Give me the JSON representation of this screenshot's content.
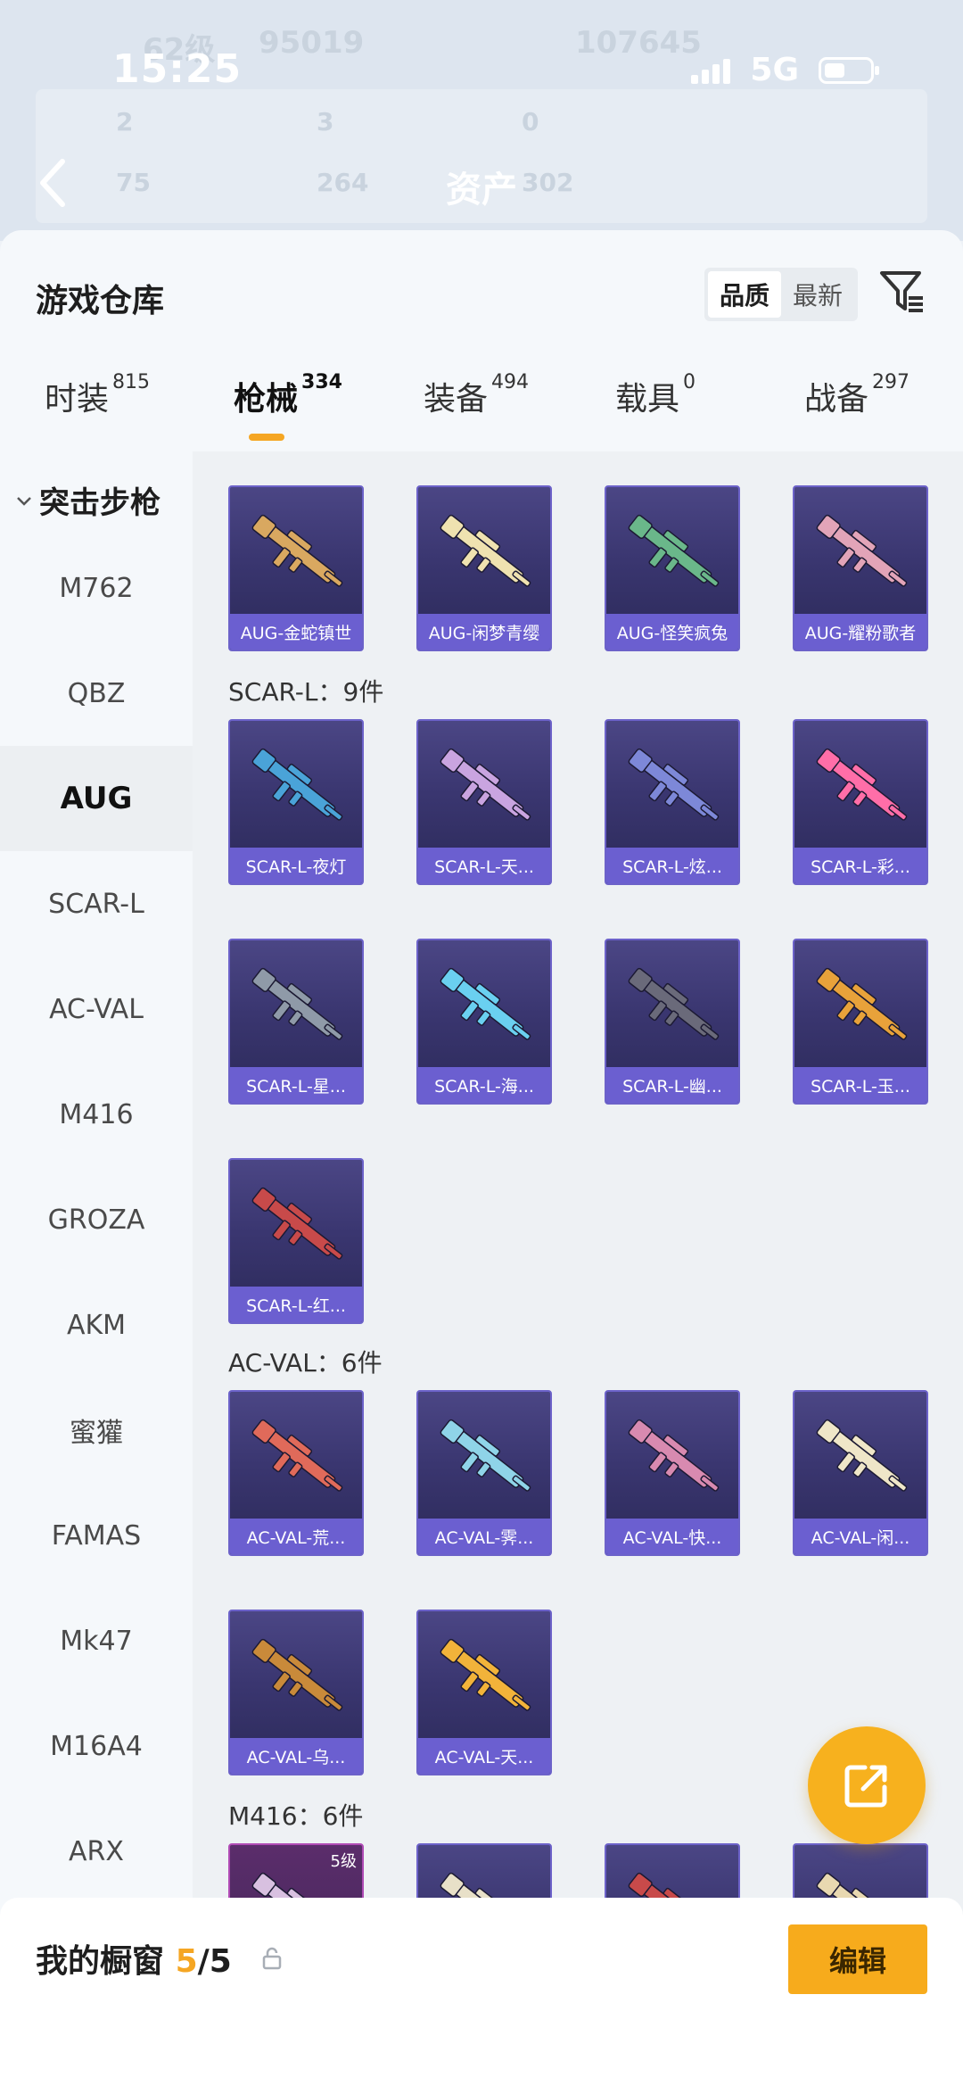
{
  "status": {
    "time": "15:25",
    "network": "5G"
  },
  "background": {
    "level": "62级",
    "coins": "95019",
    "points": "107645",
    "stats_row1": [
      "2",
      "3",
      "0"
    ],
    "stats_row2": [
      "75",
      "264",
      "302"
    ],
    "page_title": "资产"
  },
  "header": {
    "title": "游戏仓库",
    "sort_options": [
      "品质",
      "最新"
    ],
    "sort_active": "品质"
  },
  "tabs": [
    {
      "label": "时装",
      "count": "815"
    },
    {
      "label": "枪械",
      "count": "334"
    },
    {
      "label": "装备",
      "count": "494"
    },
    {
      "label": "载具",
      "count": "0"
    },
    {
      "label": "战备",
      "count": "297"
    }
  ],
  "categories": {
    "section": "突击步枪",
    "items": [
      "M762",
      "QBZ",
      "AUG",
      "SCAR-L",
      "AC-VAL",
      "M416",
      "GROZA",
      "AKM",
      "蜜獾",
      "FAMAS",
      "Mk47",
      "M16A4",
      "ARX"
    ],
    "active": "AUG"
  },
  "groups": {
    "aug_items": [
      "AUG-金蛇镇世",
      "AUG-闲梦青缨",
      "AUG-怪笑疯兔",
      "AUG-耀粉歌者"
    ],
    "scar": {
      "label": "SCAR-L：9件",
      "items": [
        "SCAR-L-夜灯",
        "SCAR-L-天...",
        "SCAR-L-炫...",
        "SCAR-L-彩...",
        "SCAR-L-星...",
        "SCAR-L-海...",
        "SCAR-L-幽...",
        "SCAR-L-玉...",
        "SCAR-L-红..."
      ]
    },
    "acval": {
      "label": "AC-VAL：6件",
      "items": [
        "AC-VAL-荒...",
        "AC-VAL-霁...",
        "AC-VAL-快...",
        "AC-VAL-闲...",
        "AC-VAL-乌...",
        "AC-VAL-天..."
      ]
    },
    "m416": {
      "label": "M416：6件",
      "first_level": "5级"
    }
  },
  "colors": {
    "aug": [
      "#d9a860",
      "#efe2b0",
      "#6ab78a",
      "#e2a4b8"
    ],
    "scar": [
      "#4aa3d8",
      "#c9a4e0",
      "#7d88d8",
      "#ff6ea8",
      "#8f9aa8",
      "#6ad0f0",
      "#6a6a7a",
      "#e8a23a",
      "#c84a4a"
    ],
    "acval": [
      "#e06a5a",
      "#8fd4e8",
      "#d88ab0",
      "#efe6c8",
      "#c98a3a",
      "#f2b33a"
    ],
    "m416": [
      "#d8c0e0",
      "#e8e0c8",
      "#c84a4a",
      "#e8d8b0"
    ]
  },
  "showcase": {
    "label": "我的橱窗",
    "current": "5",
    "total": "/5",
    "edit": "编辑"
  }
}
